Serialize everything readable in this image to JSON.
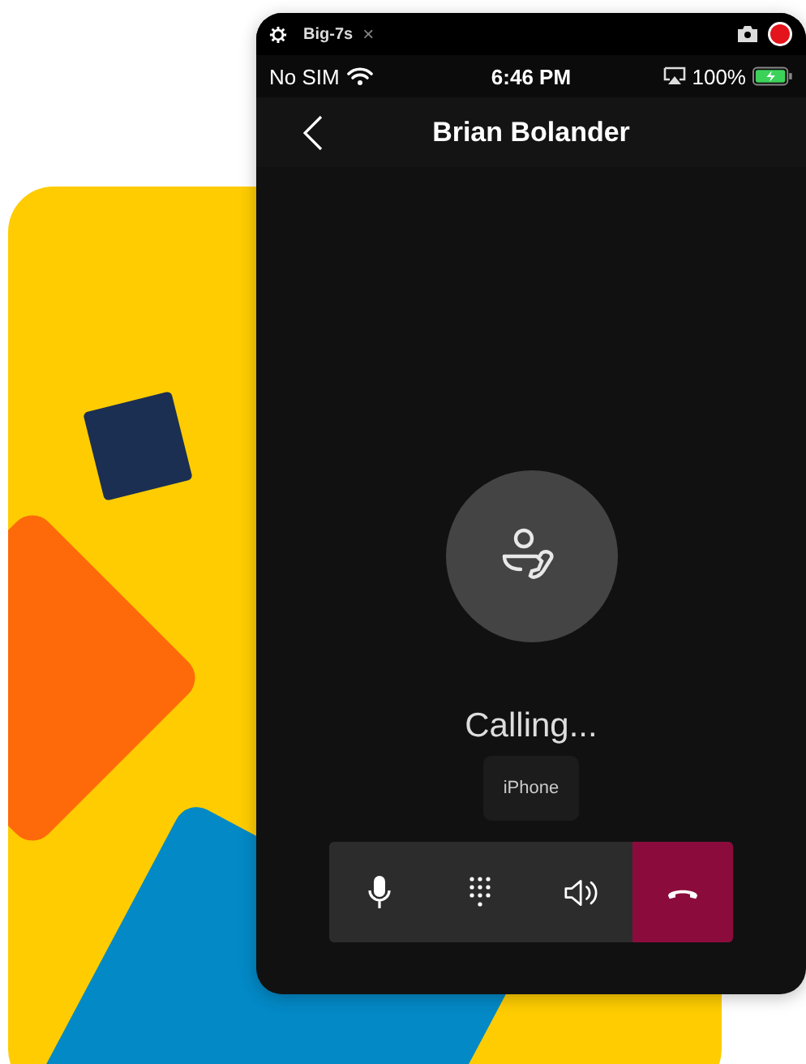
{
  "simulator_bar": {
    "tab": "Big-7s",
    "close": "×"
  },
  "status_bar": {
    "carrier": "No SIM",
    "time": "6:46 PM",
    "battery": "100%"
  },
  "header": {
    "title": "Brian Bolander"
  },
  "call": {
    "status": "Calling...",
    "device": "iPhone"
  },
  "controls": [
    {
      "kind": "mic"
    },
    {
      "kind": "keypad"
    },
    {
      "kind": "speaker"
    },
    {
      "kind": "hangup"
    }
  ]
}
